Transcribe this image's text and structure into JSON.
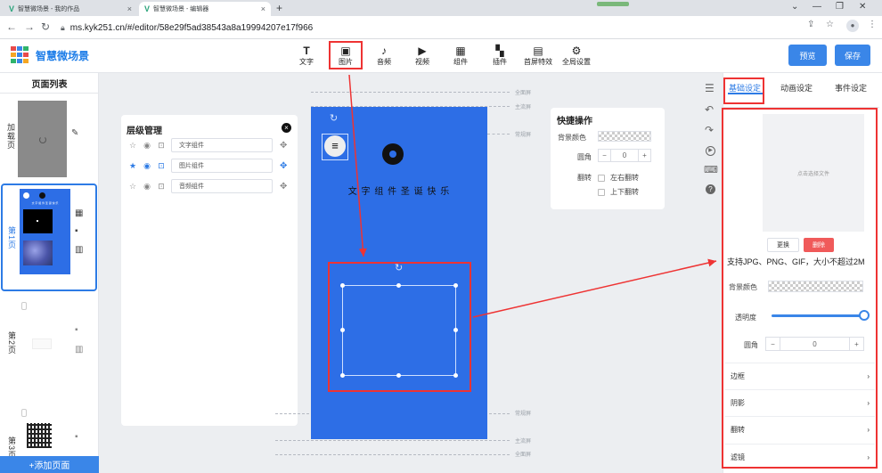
{
  "browser": {
    "tabs": [
      {
        "title": "智慧微场景 - 我的作品"
      },
      {
        "title": "智慧微场景 - 编辑器"
      }
    ],
    "url": "ms.kyk251.cn/#/editor/58e29f5ad38543a8a19994207e17f966"
  },
  "app": {
    "brand": "智慧微场景",
    "toolbar": [
      {
        "icon": "T",
        "label": "文字"
      },
      {
        "icon": "▣",
        "label": "图片"
      },
      {
        "icon": "♪",
        "label": "音频"
      },
      {
        "icon": "▶",
        "label": "视频"
      },
      {
        "icon": "▦",
        "label": "组件"
      },
      {
        "icon": "▚",
        "label": "插件"
      },
      {
        "icon": "▤",
        "label": "首屏特效"
      },
      {
        "icon": "⚙",
        "label": "全局设置"
      }
    ],
    "preview_label": "预览",
    "save_label": "保存"
  },
  "pages": {
    "title": "页面列表",
    "items": [
      {
        "label": "加载页"
      },
      {
        "label": "第1页"
      },
      {
        "label": "第2页"
      },
      {
        "label": "第3页"
      }
    ],
    "thumb1_text": "文 字 组 件 圣 诞 快 乐",
    "add_label": "+添加页面"
  },
  "layers": {
    "title": "层级管理",
    "items": [
      {
        "name": "文字组件",
        "starred": false
      },
      {
        "name": "图片组件",
        "starred": true
      },
      {
        "name": "音频组件",
        "starred": false
      }
    ]
  },
  "canvas": {
    "text": "文 字 组 件 圣 诞 快 乐",
    "guides": {
      "full": "全面屏",
      "main": "主流屏",
      "normal": "常规屏"
    }
  },
  "quick": {
    "title": "快捷操作",
    "bg_label": "背景颜色",
    "radius_label": "圆角",
    "radius_value": "0",
    "flip_label": "翻转",
    "flip_h": "左右翻转",
    "flip_v": "上下翻转"
  },
  "settings": {
    "tabs": [
      "基础设定",
      "动画设定",
      "事件设定"
    ],
    "upload_hint": "点击选择文件",
    "replace_label": "更换",
    "delete_label": "删除",
    "support_text": "支持JPG、PNG、GIF，大小不超过2M",
    "bg_label": "背景颜色",
    "opacity_label": "透明度",
    "opacity": 1.0,
    "radius_label": "圆角",
    "radius_value": "0",
    "sections": [
      "边框",
      "阴影",
      "翻转",
      "滤镜"
    ]
  },
  "colors": {
    "accent": "#3a86e8",
    "canvas": "#2d6ee6",
    "highlight": "#e33333",
    "delete": "#f05a5a"
  }
}
